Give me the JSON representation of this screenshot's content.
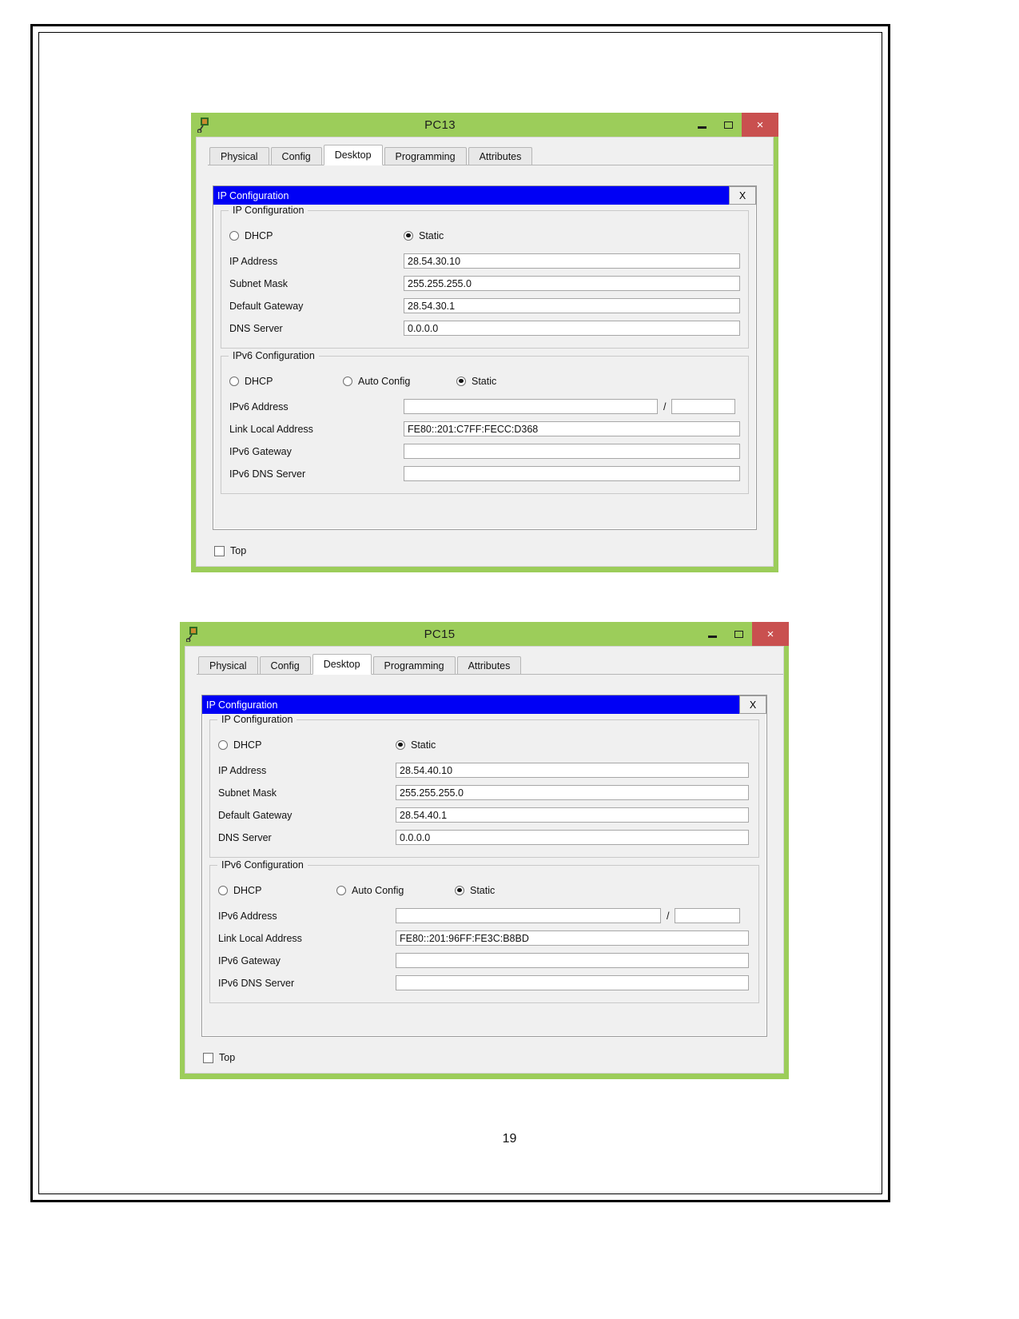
{
  "document": {
    "page_number": "19"
  },
  "windows": [
    {
      "id": "pc13",
      "title": "PC13",
      "icon": "packet-tracer-device-icon",
      "titlebar_buttons": {
        "minimize": "–",
        "maximize": "□",
        "close": "×"
      },
      "tabs": [
        {
          "label": "Physical",
          "active": false
        },
        {
          "label": "Config",
          "active": false
        },
        {
          "label": "Desktop",
          "active": true
        },
        {
          "label": "Programming",
          "active": false
        },
        {
          "label": "Attributes",
          "active": false
        }
      ],
      "subwindow": {
        "title": "IP Configuration",
        "close_label": "X"
      },
      "ipv4": {
        "legend": "IP Configuration",
        "modes": [
          {
            "label": "DHCP",
            "selected": false
          },
          {
            "label": "Static",
            "selected": true
          }
        ],
        "fields": [
          {
            "label": "IP Address",
            "value": "28.54.30.10"
          },
          {
            "label": "Subnet Mask",
            "value": "255.255.255.0"
          },
          {
            "label": "Default Gateway",
            "value": "28.54.30.1"
          },
          {
            "label": "DNS Server",
            "value": "0.0.0.0"
          }
        ]
      },
      "ipv6": {
        "legend": "IPv6 Configuration",
        "modes": [
          {
            "label": "DHCP",
            "selected": false
          },
          {
            "label": "Auto Config",
            "selected": false
          },
          {
            "label": "Static",
            "selected": true
          }
        ],
        "address": {
          "label": "IPv6 Address",
          "value": "",
          "separator": "/",
          "prefix": ""
        },
        "fields": [
          {
            "label": "Link Local Address",
            "value": "FE80::201:C7FF:FECC:D368"
          },
          {
            "label": "IPv6 Gateway",
            "value": ""
          },
          {
            "label": "IPv6 DNS Server",
            "value": ""
          }
        ]
      },
      "top_checkbox": {
        "label": "Top",
        "checked": false
      }
    },
    {
      "id": "pc15",
      "title": "PC15",
      "icon": "packet-tracer-device-icon",
      "titlebar_buttons": {
        "minimize": "–",
        "maximize": "□",
        "close": "×"
      },
      "tabs": [
        {
          "label": "Physical",
          "active": false
        },
        {
          "label": "Config",
          "active": false
        },
        {
          "label": "Desktop",
          "active": true
        },
        {
          "label": "Programming",
          "active": false
        },
        {
          "label": "Attributes",
          "active": false
        }
      ],
      "subwindow": {
        "title": "IP Configuration",
        "close_label": "X"
      },
      "ipv4": {
        "legend": "IP Configuration",
        "modes": [
          {
            "label": "DHCP",
            "selected": false
          },
          {
            "label": "Static",
            "selected": true
          }
        ],
        "fields": [
          {
            "label": "IP Address",
            "value": "28.54.40.10"
          },
          {
            "label": "Subnet Mask",
            "value": "255.255.255.0"
          },
          {
            "label": "Default Gateway",
            "value": "28.54.40.1"
          },
          {
            "label": "DNS Server",
            "value": "0.0.0.0"
          }
        ]
      },
      "ipv6": {
        "legend": "IPv6 Configuration",
        "modes": [
          {
            "label": "DHCP",
            "selected": false
          },
          {
            "label": "Auto Config",
            "selected": false
          },
          {
            "label": "Static",
            "selected": true
          }
        ],
        "address": {
          "label": "IPv6 Address",
          "value": "",
          "separator": "/",
          "prefix": ""
        },
        "fields": [
          {
            "label": "Link Local Address",
            "value": "FE80::201:96FF:FE3C:B8BD"
          },
          {
            "label": "IPv6 Gateway",
            "value": ""
          },
          {
            "label": "IPv6 DNS Server",
            "value": ""
          }
        ]
      },
      "top_checkbox": {
        "label": "Top",
        "checked": false
      }
    }
  ],
  "colors": {
    "window_chrome": "#9ccd5a",
    "close_button": "#c9504f",
    "subwindow_title": "#0000f5",
    "panel": "#f0f0f0"
  }
}
